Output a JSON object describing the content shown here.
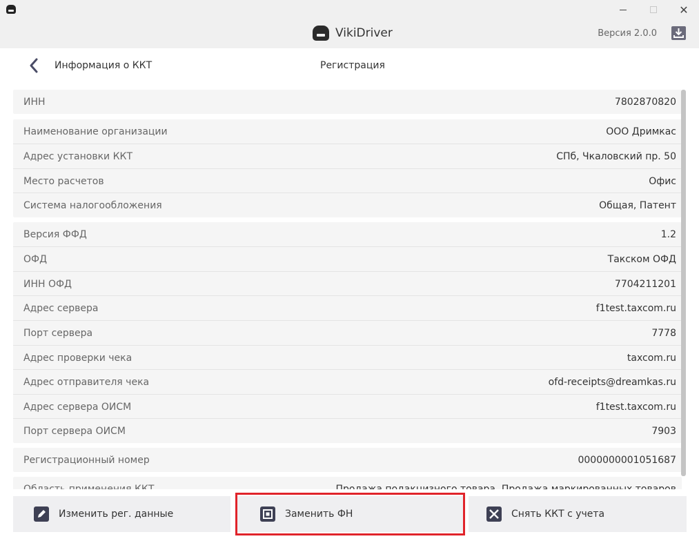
{
  "window": {
    "title": "VikiDriver",
    "version": "Версия 2.0.0"
  },
  "nav": {
    "back_title": "Информация о ККТ",
    "center_title": "Регистрация"
  },
  "groups": [
    {
      "rows": [
        {
          "label": "ИНН",
          "value": "7802870820"
        }
      ]
    },
    {
      "rows": [
        {
          "label": "Наименование организации",
          "value": "ООО Дримкас"
        },
        {
          "label": "Адрес установки ККТ",
          "value": "СПб, Чкаловский пр. 50"
        },
        {
          "label": "Место расчетов",
          "value": "Офис"
        },
        {
          "label": "Система налогообложения",
          "value": "Общая, Патент"
        }
      ]
    },
    {
      "rows": [
        {
          "label": "Версия ФФД",
          "value": "1.2"
        },
        {
          "label": "ОФД",
          "value": "Такском ОФД"
        },
        {
          "label": "ИНН ОФД",
          "value": "7704211201"
        },
        {
          "label": "Адрес сервера",
          "value": "f1test.taxcom.ru"
        },
        {
          "label": "Порт сервера",
          "value": "7778"
        },
        {
          "label": "Адрес проверки чека",
          "value": "taxcom.ru"
        },
        {
          "label": "Адрес отправителя чека",
          "value": "ofd-receipts@dreamkas.ru"
        },
        {
          "label": "Адрес сервера ОИСМ",
          "value": "f1test.taxcom.ru"
        },
        {
          "label": "Порт сервера ОИСМ",
          "value": "7903"
        }
      ]
    },
    {
      "rows": [
        {
          "label": "Регистрационный номер",
          "value": "0000000001051687"
        }
      ]
    },
    {
      "rows": [
        {
          "label": "Область применения ККТ",
          "value": "Продажа подакцизного товара, Продажа маркированных товаров"
        }
      ]
    }
  ],
  "footer": {
    "edit_label": "Изменить рег. данные",
    "replace_fn_label": "Заменить ФН",
    "deregister_label": "Снять ККТ с учета"
  },
  "colors": {
    "highlight": "#e0232a",
    "icon_bg": "#3e4054"
  }
}
